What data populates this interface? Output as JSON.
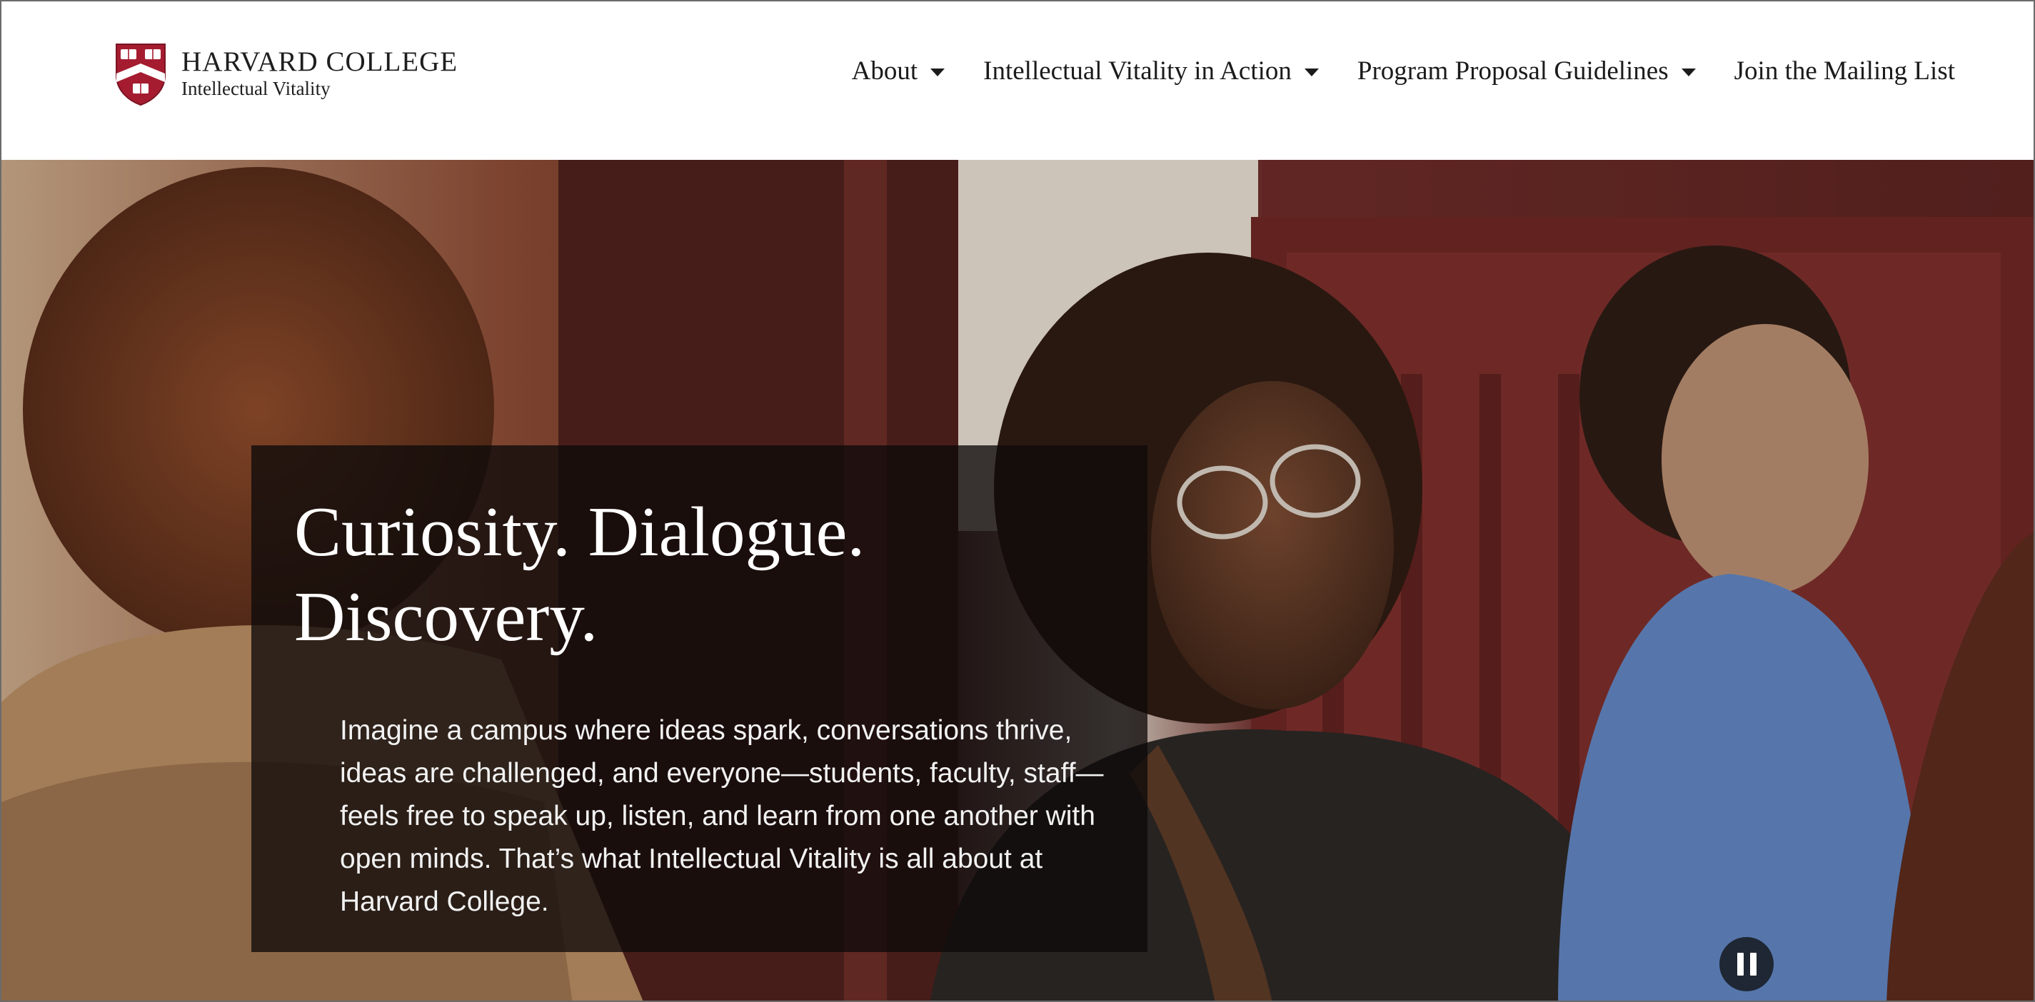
{
  "brand": {
    "title": "HARVARD COLLEGE",
    "subtitle": "Intellectual Vitality",
    "shield_color": "#a51c30",
    "shield_letters": "VERITAS"
  },
  "nav": {
    "items": [
      {
        "label": "About",
        "has_dropdown": true
      },
      {
        "label": "Intellectual Vitality in Action",
        "has_dropdown": true
      },
      {
        "label": "Program Proposal Guidelines",
        "has_dropdown": true
      },
      {
        "label": "Join the Mailing List",
        "has_dropdown": false
      }
    ]
  },
  "hero": {
    "title": "Curiosity. Dialogue. Discovery.",
    "body": "Imagine a campus where ideas spark, conversations thrive, ideas are challenged, and everyone—students, faculty, staff—feels free to speak up, listen, and learn from one another with open minds. That’s what Intellectual Vitality is all about at Harvard College.",
    "media_control": {
      "icon": "pause-icon",
      "state": "playing"
    }
  },
  "colors": {
    "header_bg": "#ffffff",
    "nav_text": "#1b1b1b",
    "caption_bg": "#0e0a0a",
    "hero_text": "#ffffff",
    "pause_button_bg": "#1e2733"
  }
}
